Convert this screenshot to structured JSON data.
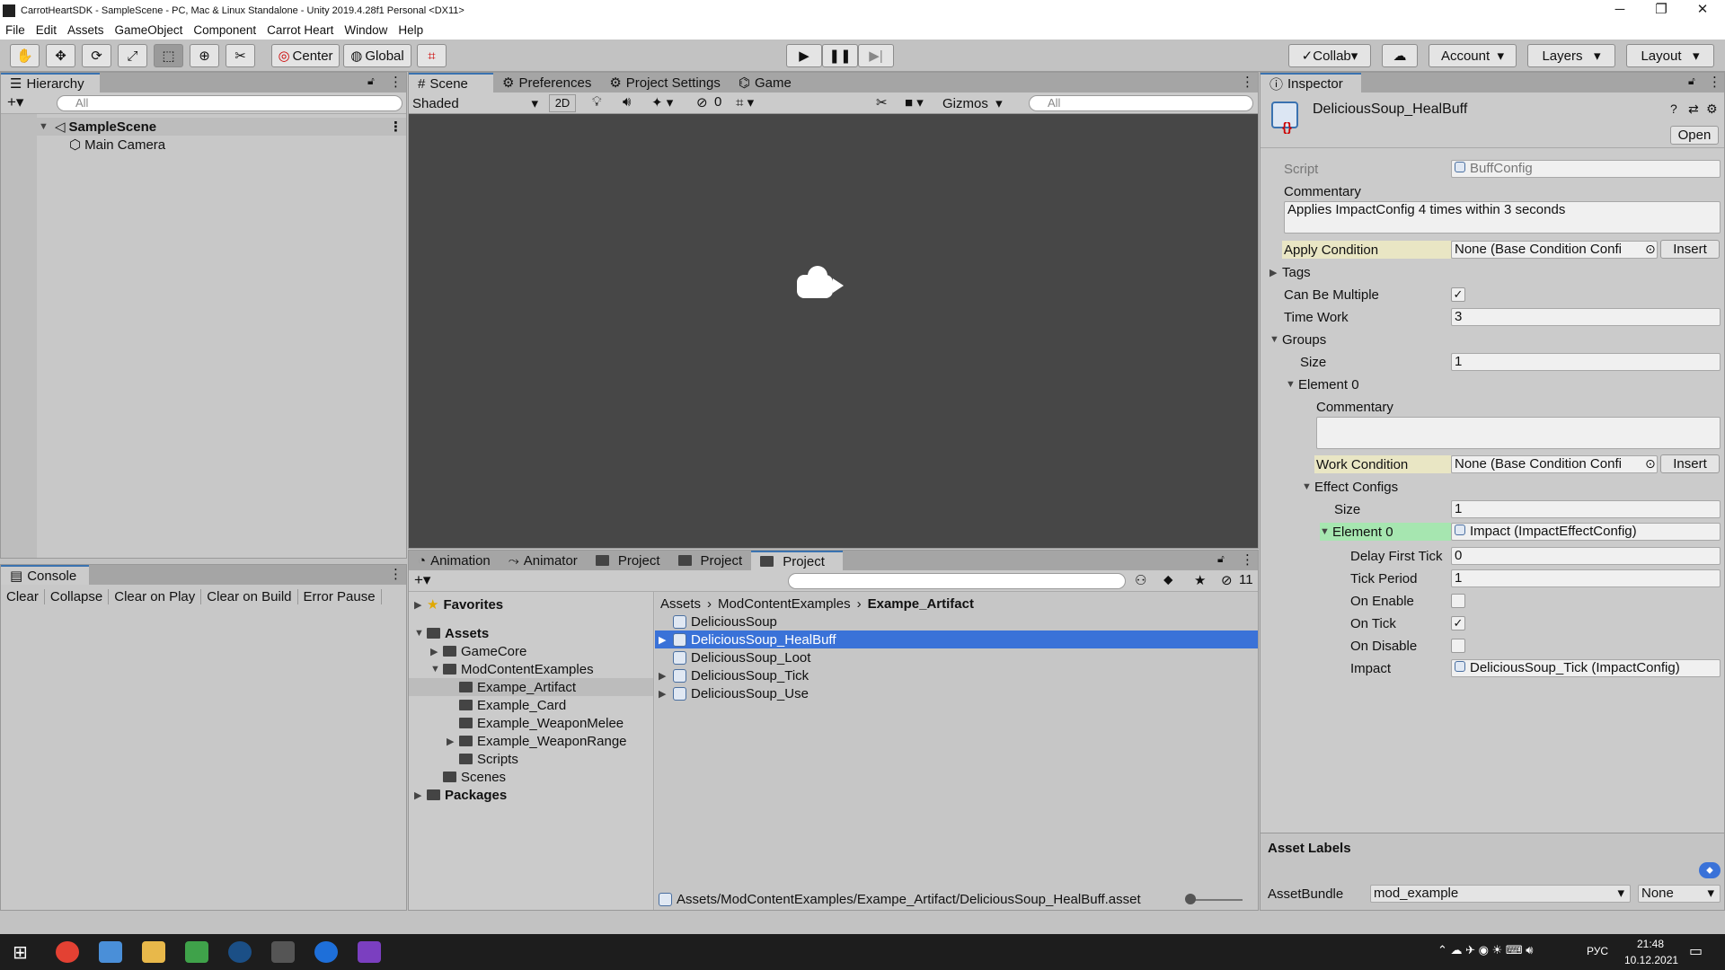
{
  "window": {
    "title": "CarrotHeartSDK - SampleScene - PC, Mac & Linux Standalone - Unity 2019.4.28f1 Personal <DX11>",
    "minimize": "─",
    "maximize": "❐",
    "close": "✕"
  },
  "menu": [
    "File",
    "Edit",
    "Assets",
    "GameObject",
    "Component",
    "Carrot Heart",
    "Window",
    "Help"
  ],
  "toolbar": {
    "center": "Center",
    "global": "Global",
    "collab": "Collab",
    "account": "Account",
    "layers": "Layers",
    "layout": "Layout"
  },
  "hierarchy": {
    "tab": "Hierarchy",
    "search_placeholder": "All",
    "scene": "SampleScene",
    "items": [
      "Main Camera"
    ]
  },
  "console": {
    "tab": "Console",
    "buttons": [
      "Clear",
      "Collapse",
      "Clear on Play",
      "Clear on Build",
      "Error Pause"
    ]
  },
  "scene": {
    "tabs": [
      "Scene",
      "Preferences",
      "Project Settings",
      "Game"
    ],
    "shading": "Shaded",
    "mode2d": "2D",
    "hidden_count": "0",
    "gizmos": "Gizmos",
    "search_placeholder": "All"
  },
  "project": {
    "tabs": [
      "Animation",
      "Animator",
      "Project",
      "Project",
      "Project"
    ],
    "hidden_count": "11",
    "favorites": "Favorites",
    "assets": "Assets",
    "tree": [
      "GameCore",
      "ModContentExamples",
      "Exampe_Artifact",
      "Example_Card",
      "Example_WeaponMelee",
      "Example_WeaponRange",
      "Scripts",
      "Scenes"
    ],
    "packages": "Packages",
    "breadcrumb": [
      "Assets",
      "ModContentExamples",
      "Exampe_Artifact"
    ],
    "files": [
      "DeliciousSoup",
      "DeliciousSoup_HealBuff",
      "DeliciousSoup_Loot",
      "DeliciousSoup_Tick",
      "DeliciousSoup_Use"
    ],
    "status_path": "Assets/ModContentExamples/Exampe_Artifact/DeliciousSoup_HealBuff.asset"
  },
  "inspector": {
    "tab": "Inspector",
    "asset_name": "DeliciousSoup_HealBuff",
    "open": "Open",
    "fields": {
      "script_label": "Script",
      "script_value": "BuffConfig",
      "commentary_label": "Commentary",
      "commentary_value": "Applies ImpactConfig 4 times within 3 seconds",
      "apply_condition_label": "Apply Condition",
      "apply_condition_value": "None (Base Condition Confi",
      "insert": "Insert",
      "tags": "Tags",
      "can_be_multiple": "Can Be Multiple",
      "time_work_label": "Time Work",
      "time_work_value": "3",
      "groups": "Groups",
      "size_label": "Size",
      "groups_size": "1",
      "element0": "Element 0",
      "el_commentary": "Commentary",
      "work_condition_label": "Work Condition",
      "work_condition_value": "None (Base Condition Confi",
      "effect_configs": "Effect Configs",
      "effect_size": "1",
      "effect_element0": "Element 0",
      "effect_element0_value": "Impact (ImpactEffectConfig)",
      "delay_first_tick_label": "Delay First Tick",
      "delay_first_tick_value": "0",
      "tick_period_label": "Tick Period",
      "tick_period_value": "1",
      "on_enable": "On Enable",
      "on_tick": "On Tick",
      "on_disable": "On Disable",
      "impact_label": "Impact",
      "impact_value": "DeliciousSoup_Tick (ImpactConfig)"
    },
    "asset_labels": "Asset Labels",
    "asset_bundle_label": "AssetBundle",
    "asset_bundle_value": "mod_example",
    "asset_variant": "None"
  },
  "tray": {
    "lang": "РУС",
    "time": "21:48",
    "date": "10.12.2021"
  },
  "colors": {
    "selection": "#3a72d8",
    "highlight_yellow": "#e9e6c4",
    "highlight_green": "#a6e6b0"
  }
}
